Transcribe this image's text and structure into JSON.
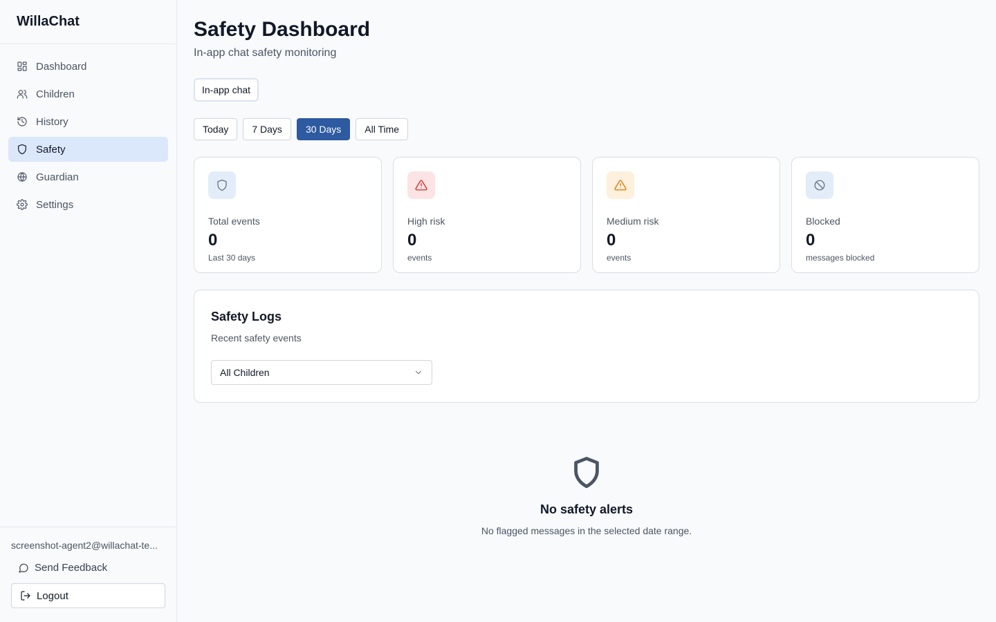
{
  "app": {
    "name": "WillaChat"
  },
  "sidebar": {
    "items": [
      {
        "label": "Dashboard",
        "icon": "dashboard-icon"
      },
      {
        "label": "Children",
        "icon": "users-icon"
      },
      {
        "label": "History",
        "icon": "history-icon"
      },
      {
        "label": "Safety",
        "icon": "shield-icon",
        "active": true
      },
      {
        "label": "Guardian",
        "icon": "globe-icon"
      },
      {
        "label": "Settings",
        "icon": "gear-icon"
      }
    ],
    "user_email": "screenshot-agent2@willachat-te...",
    "feedback_label": "Send Feedback",
    "logout_label": "Logout"
  },
  "header": {
    "title": "Safety Dashboard",
    "subtitle": "In-app chat safety monitoring",
    "source_chip": "In-app chat"
  },
  "range": {
    "options": [
      "Today",
      "7 Days",
      "30 Days",
      "All Time"
    ],
    "selected": "30 Days"
  },
  "stats": [
    {
      "label": "Total events",
      "value": "0",
      "note": "Last 30 days",
      "icon": "shield-icon",
      "color": "#6b7280",
      "bg": "#e3edf9"
    },
    {
      "label": "High risk",
      "value": "0",
      "note": "events",
      "icon": "alert-triangle-icon",
      "color": "#dc2626",
      "bg": "#fde4e4"
    },
    {
      "label": "Medium risk",
      "value": "0",
      "note": "events",
      "icon": "alert-triangle-icon",
      "color": "#d97706",
      "bg": "#fdf0dc"
    },
    {
      "label": "Blocked",
      "value": "0",
      "note": "messages blocked",
      "icon": "ban-icon",
      "color": "#6b7280",
      "bg": "#e3edf9"
    }
  ],
  "logs": {
    "title": "Safety Logs",
    "subtitle": "Recent safety events",
    "filter_value": "All Children"
  },
  "empty": {
    "title": "No safety alerts",
    "subtitle": "No flagged messages in the selected date range."
  },
  "colors": {
    "accent": "#2d5aa0",
    "active_nav_bg": "#dbe7fb"
  }
}
